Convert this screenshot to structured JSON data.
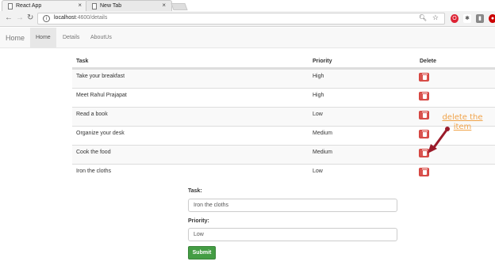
{
  "browser": {
    "tabs": [
      {
        "title": "React App",
        "close": "×"
      },
      {
        "title": "New Tab",
        "close": "×"
      }
    ],
    "url": {
      "host": "localhost",
      "path": ":4600/details"
    },
    "nav": {
      "back": "←",
      "forward": "→",
      "reload": "↻"
    }
  },
  "appnav": {
    "brand": "Home",
    "links": [
      "Home",
      "Details",
      "AboutUs"
    ],
    "active": "Home"
  },
  "table": {
    "headers": {
      "task": "Task",
      "priority": "Priority",
      "delete": "Delete"
    },
    "rows": [
      {
        "task": "Take your breakfast",
        "priority": "High"
      },
      {
        "task": "Meet Rahul Prajapat",
        "priority": "High"
      },
      {
        "task": "Read a book",
        "priority": "Low"
      },
      {
        "task": "Organize your desk",
        "priority": "Medium"
      },
      {
        "task": "Cook the food",
        "priority": "Medium"
      },
      {
        "task": "Iron the cloths",
        "priority": "Low"
      }
    ]
  },
  "annotation": {
    "text": "delete the item",
    "color": "#f0a34a",
    "arrow_color": "#9b1b2a"
  },
  "form": {
    "task_label": "Task:",
    "task_value": "Iron the cloths",
    "priority_label": "Priority:",
    "priority_value": "Low",
    "submit_label": "Submit"
  },
  "colors": {
    "danger": "#d9534f",
    "success": "#449d44"
  }
}
